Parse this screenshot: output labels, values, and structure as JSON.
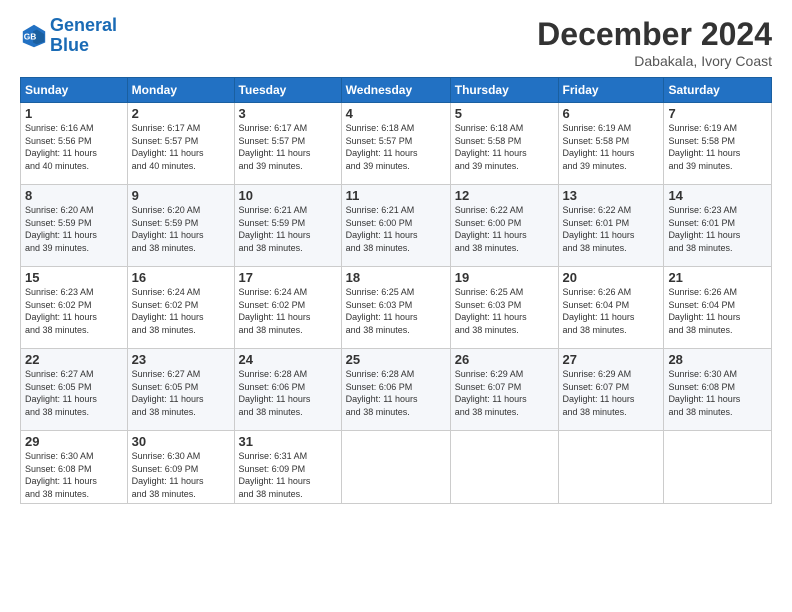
{
  "header": {
    "logo_line1": "General",
    "logo_line2": "Blue",
    "title": "December 2024",
    "location": "Dabakala, Ivory Coast"
  },
  "days_of_week": [
    "Sunday",
    "Monday",
    "Tuesday",
    "Wednesday",
    "Thursday",
    "Friday",
    "Saturday"
  ],
  "weeks": [
    [
      {
        "day": "1",
        "info": "Sunrise: 6:16 AM\nSunset: 5:56 PM\nDaylight: 11 hours\nand 40 minutes."
      },
      {
        "day": "2",
        "info": "Sunrise: 6:17 AM\nSunset: 5:57 PM\nDaylight: 11 hours\nand 40 minutes."
      },
      {
        "day": "3",
        "info": "Sunrise: 6:17 AM\nSunset: 5:57 PM\nDaylight: 11 hours\nand 39 minutes."
      },
      {
        "day": "4",
        "info": "Sunrise: 6:18 AM\nSunset: 5:57 PM\nDaylight: 11 hours\nand 39 minutes."
      },
      {
        "day": "5",
        "info": "Sunrise: 6:18 AM\nSunset: 5:58 PM\nDaylight: 11 hours\nand 39 minutes."
      },
      {
        "day": "6",
        "info": "Sunrise: 6:19 AM\nSunset: 5:58 PM\nDaylight: 11 hours\nand 39 minutes."
      },
      {
        "day": "7",
        "info": "Sunrise: 6:19 AM\nSunset: 5:58 PM\nDaylight: 11 hours\nand 39 minutes."
      }
    ],
    [
      {
        "day": "8",
        "info": "Sunrise: 6:20 AM\nSunset: 5:59 PM\nDaylight: 11 hours\nand 39 minutes."
      },
      {
        "day": "9",
        "info": "Sunrise: 6:20 AM\nSunset: 5:59 PM\nDaylight: 11 hours\nand 38 minutes."
      },
      {
        "day": "10",
        "info": "Sunrise: 6:21 AM\nSunset: 5:59 PM\nDaylight: 11 hours\nand 38 minutes."
      },
      {
        "day": "11",
        "info": "Sunrise: 6:21 AM\nSunset: 6:00 PM\nDaylight: 11 hours\nand 38 minutes."
      },
      {
        "day": "12",
        "info": "Sunrise: 6:22 AM\nSunset: 6:00 PM\nDaylight: 11 hours\nand 38 minutes."
      },
      {
        "day": "13",
        "info": "Sunrise: 6:22 AM\nSunset: 6:01 PM\nDaylight: 11 hours\nand 38 minutes."
      },
      {
        "day": "14",
        "info": "Sunrise: 6:23 AM\nSunset: 6:01 PM\nDaylight: 11 hours\nand 38 minutes."
      }
    ],
    [
      {
        "day": "15",
        "info": "Sunrise: 6:23 AM\nSunset: 6:02 PM\nDaylight: 11 hours\nand 38 minutes."
      },
      {
        "day": "16",
        "info": "Sunrise: 6:24 AM\nSunset: 6:02 PM\nDaylight: 11 hours\nand 38 minutes."
      },
      {
        "day": "17",
        "info": "Sunrise: 6:24 AM\nSunset: 6:02 PM\nDaylight: 11 hours\nand 38 minutes."
      },
      {
        "day": "18",
        "info": "Sunrise: 6:25 AM\nSunset: 6:03 PM\nDaylight: 11 hours\nand 38 minutes."
      },
      {
        "day": "19",
        "info": "Sunrise: 6:25 AM\nSunset: 6:03 PM\nDaylight: 11 hours\nand 38 minutes."
      },
      {
        "day": "20",
        "info": "Sunrise: 6:26 AM\nSunset: 6:04 PM\nDaylight: 11 hours\nand 38 minutes."
      },
      {
        "day": "21",
        "info": "Sunrise: 6:26 AM\nSunset: 6:04 PM\nDaylight: 11 hours\nand 38 minutes."
      }
    ],
    [
      {
        "day": "22",
        "info": "Sunrise: 6:27 AM\nSunset: 6:05 PM\nDaylight: 11 hours\nand 38 minutes."
      },
      {
        "day": "23",
        "info": "Sunrise: 6:27 AM\nSunset: 6:05 PM\nDaylight: 11 hours\nand 38 minutes."
      },
      {
        "day": "24",
        "info": "Sunrise: 6:28 AM\nSunset: 6:06 PM\nDaylight: 11 hours\nand 38 minutes."
      },
      {
        "day": "25",
        "info": "Sunrise: 6:28 AM\nSunset: 6:06 PM\nDaylight: 11 hours\nand 38 minutes."
      },
      {
        "day": "26",
        "info": "Sunrise: 6:29 AM\nSunset: 6:07 PM\nDaylight: 11 hours\nand 38 minutes."
      },
      {
        "day": "27",
        "info": "Sunrise: 6:29 AM\nSunset: 6:07 PM\nDaylight: 11 hours\nand 38 minutes."
      },
      {
        "day": "28",
        "info": "Sunrise: 6:30 AM\nSunset: 6:08 PM\nDaylight: 11 hours\nand 38 minutes."
      }
    ],
    [
      {
        "day": "29",
        "info": "Sunrise: 6:30 AM\nSunset: 6:08 PM\nDaylight: 11 hours\nand 38 minutes."
      },
      {
        "day": "30",
        "info": "Sunrise: 6:30 AM\nSunset: 6:09 PM\nDaylight: 11 hours\nand 38 minutes."
      },
      {
        "day": "31",
        "info": "Sunrise: 6:31 AM\nSunset: 6:09 PM\nDaylight: 11 hours\nand 38 minutes."
      },
      {
        "day": "",
        "info": ""
      },
      {
        "day": "",
        "info": ""
      },
      {
        "day": "",
        "info": ""
      },
      {
        "day": "",
        "info": ""
      }
    ]
  ]
}
